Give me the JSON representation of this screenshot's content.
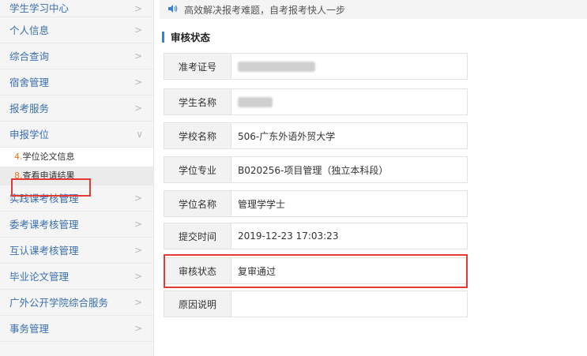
{
  "sidebar": {
    "items_top": [
      {
        "label": "学生学习中心"
      },
      {
        "label": "个人信息"
      },
      {
        "label": "综合查询"
      },
      {
        "label": "宿舍管理"
      },
      {
        "label": "报考服务"
      },
      {
        "label": "申报学位"
      }
    ],
    "sub_items": [
      {
        "num": "4.",
        "label": "学位论文信息"
      },
      {
        "num": "8.",
        "label": "查看申请结果"
      }
    ],
    "items_bottom": [
      {
        "label": "实践课考核管理"
      },
      {
        "label": "委考课考核管理"
      },
      {
        "label": "互认课考核管理"
      },
      {
        "label": "毕业论文管理"
      },
      {
        "label": "广外公开学院综合服务"
      },
      {
        "label": "事务管理"
      }
    ]
  },
  "notice": {
    "text": "高效解决报考难题，自考报考快人一步"
  },
  "section": {
    "title": "审核状态"
  },
  "rows": [
    {
      "label": "准考证号",
      "value": ""
    },
    {
      "label": "学生名称",
      "value": ""
    },
    {
      "label": "学校名称",
      "value": "506-广东外语外贸大学"
    },
    {
      "label": "学位专业",
      "value": "B020256-项目管理（独立本科段）"
    },
    {
      "label": "学位名称",
      "value": "管理学学士"
    },
    {
      "label": "提交时间",
      "value": "2019-12-23 17:03:23"
    },
    {
      "label": "审核状态",
      "value": "复审通过"
    },
    {
      "label": "原因说明",
      "value": ""
    }
  ],
  "colors": {
    "link": "#3a6fb0",
    "accent": "#3a7fd5",
    "highlight": "#e53935",
    "number": "#e87b1c"
  }
}
